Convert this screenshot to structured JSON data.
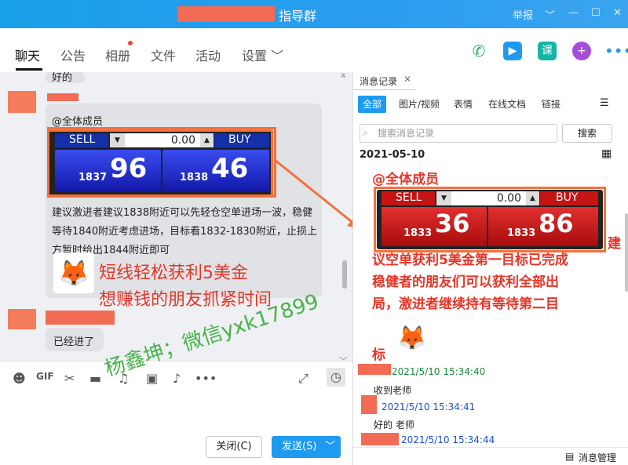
{
  "window": {
    "title": "指导群",
    "controls": [
      "举报",
      "﹀",
      "—",
      "☐",
      "✕"
    ]
  },
  "tabs": [
    "聊天",
    "公告",
    "相册",
    "文件",
    "活动",
    "设置 ﹀"
  ],
  "chat": {
    "top_text": "好的",
    "mention": "@全体成员",
    "ticker1": {
      "sell": "SELL",
      "buy": "BUY",
      "value": "0.00",
      "bid_small": "1837",
      "bid_big": "96",
      "ask_small": "1838",
      "ask_big": "46"
    },
    "body": [
      "建议激进者建议1838附近可以先轻仓空单进场一波，稳健",
      "等待1840附近考虑进场，目标看1832-1830附近，止损上",
      "方暂时给出1844附近即可"
    ],
    "promo1": "短线轻松获利5美金",
    "promo2": "想赚钱的朋友抓紧时间",
    "reply": "已经进了"
  },
  "buttons": {
    "close": "关闭(C)",
    "send": "发送(S)"
  },
  "watermark": "杨鑫坤；微信yxk17899",
  "panel": {
    "title": "消息记录",
    "filters": [
      "全部",
      "图片/视频",
      "表情",
      "在线文档",
      "链接"
    ],
    "search_placeholder": "搜索消息记录",
    "search_btn": "搜索",
    "date": "2021-05-10",
    "mention": "@全体成员",
    "ticker2": {
      "sell": "SELL",
      "buy": "BUY",
      "value": "0.00",
      "bid_small": "1833",
      "bid_big": "36",
      "ask_small": "1833",
      "ask_big": "86"
    },
    "lines": [
      "议空单获利5美金第一目标已完成",
      "稳健者的朋友们可以获利全部出",
      "局，激进者继续持有等待第二目",
      "标"
    ],
    "jian": "建",
    "messages": [
      {
        "time": "2021/5/10 15:34:40",
        "text": "收到老师"
      },
      {
        "time": "2021/5/10 15:34:41",
        "text": "好的   老师"
      },
      {
        "time": "2021/5/10 15:34:44",
        "text": ""
      }
    ],
    "footer": "消息管理"
  },
  "colors": {
    "accent": "#1e9bf0",
    "highlight": "#f3713e",
    "red_text": "#e43628"
  }
}
